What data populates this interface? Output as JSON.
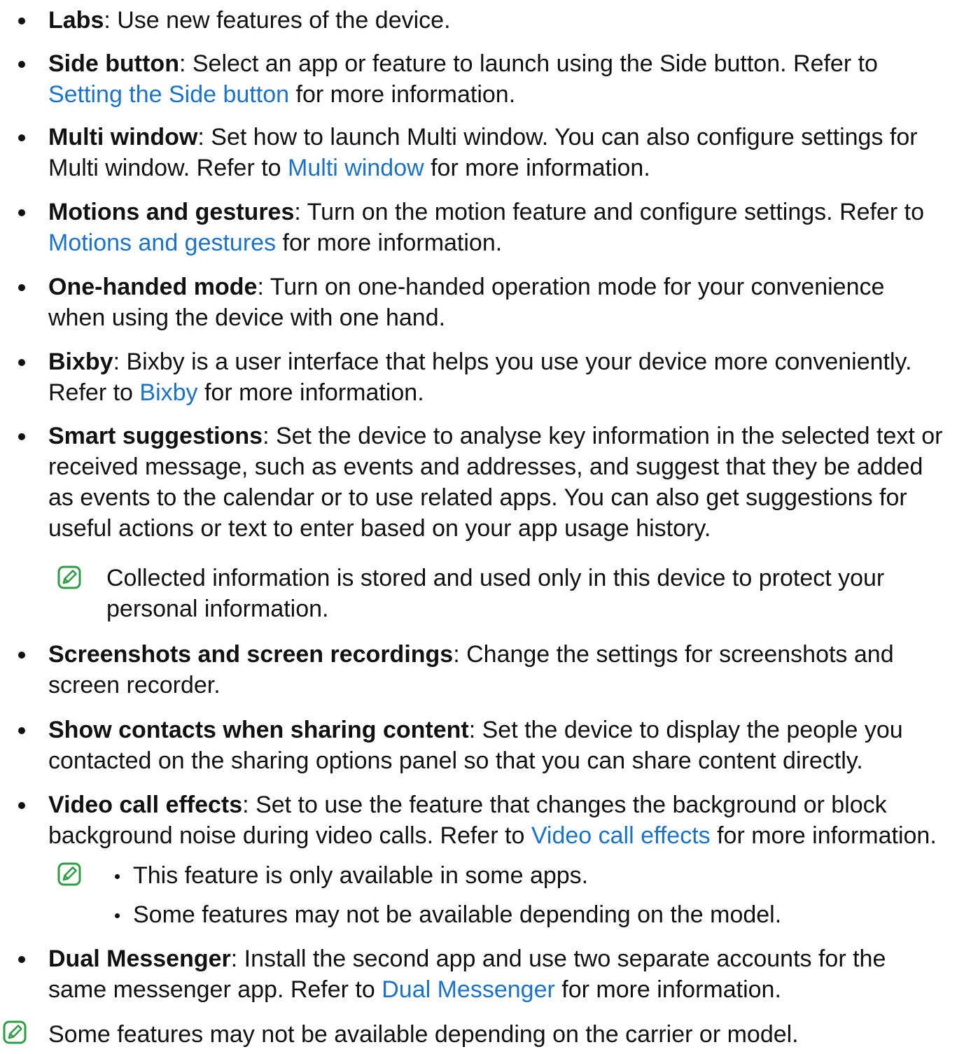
{
  "items": [
    {
      "term": "Labs",
      "before": ": Use new features of the device.",
      "link": "",
      "after": ""
    },
    {
      "term": "Side button",
      "before": ": Select an app or feature to launch using the Side button. Refer to ",
      "link": "Setting the Side button",
      "after": " for more information."
    },
    {
      "term": "Multi window",
      "before": ": Set how to launch Multi window. You can also configure settings for Multi window. Refer to ",
      "link": "Multi window",
      "after": " for more information."
    },
    {
      "term": "Motions and gestures",
      "before": ": Turn on the motion feature and configure settings. Refer to ",
      "link": "Motions and gestures",
      "after": " for more information."
    },
    {
      "term": "One-handed mode",
      "before": ": Turn on one-handed operation mode for your convenience when using the device with one hand.",
      "link": "",
      "after": ""
    },
    {
      "term": "Bixby",
      "before": ": Bixby is a user interface that helps you use your device more conveniently. Refer to ",
      "link": "Bixby",
      "after": " for more information."
    },
    {
      "term": "Smart suggestions",
      "before": ": Set the device to analyse key information in the selected text or received message, such as events and addresses, and suggest that they be added as events to the calendar or to use related apps. You can also get suggestions for useful actions or text to enter based on your app usage history.",
      "link": "",
      "after": ""
    },
    {
      "term": "Screenshots and screen recordings",
      "before": ": Change the settings for screenshots and screen recorder.",
      "link": "",
      "after": ""
    },
    {
      "term": "Show contacts when sharing content",
      "before": ": Set the device to display the people you contacted on the sharing options panel so that you can share content directly.",
      "link": "",
      "after": ""
    },
    {
      "term": "Video call effects",
      "before": ": Set to use the feature that changes the background or block background noise during video calls. Refer to ",
      "link": "Video call effects",
      "after": " for more information."
    },
    {
      "term": "Dual Messenger",
      "before": ": Install the second app and use two separate accounts for the same messenger app. Refer to ",
      "link": "Dual Messenger",
      "after": " for more information."
    }
  ],
  "notes": {
    "smart_suggestions": "Collected information is stored and used only in this device to protect your personal information.",
    "video_call_1": "This feature is only available in some apps.",
    "video_call_2": "Some features may not be available depending on the model.",
    "footer": "Some features may not be available depending on the carrier or model."
  },
  "colors": {
    "link": "#1a73c9",
    "note_icon": "#2e9e44"
  },
  "icons": {
    "note": "note-pencil-icon"
  }
}
